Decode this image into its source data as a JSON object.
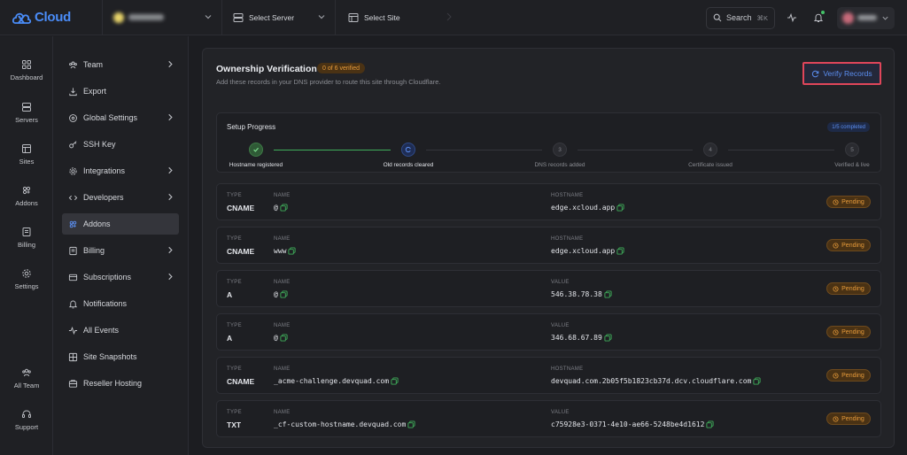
{
  "brand": {
    "name": "Cloud",
    "color": "#4a8cf7"
  },
  "topbar": {
    "server_label": "Select Server",
    "site_label": "Select Site",
    "search_label": "Search",
    "search_shortcut": "⌘K"
  },
  "rail": [
    {
      "label": "Dashboard",
      "icon": "grid-icon"
    },
    {
      "label": "Servers",
      "icon": "server-icon"
    },
    {
      "label": "Sites",
      "icon": "browser-icon"
    },
    {
      "label": "Addons",
      "icon": "addons-icon"
    },
    {
      "label": "Billing",
      "icon": "billing-icon"
    },
    {
      "label": "Settings",
      "icon": "gear-icon"
    },
    {
      "label": "All Team",
      "icon": "team-icon"
    },
    {
      "label": "Support",
      "icon": "headset-icon"
    }
  ],
  "menu": [
    {
      "label": "Team",
      "icon": "team-icon",
      "arrow": true
    },
    {
      "label": "Export",
      "icon": "export-icon",
      "arrow": false
    },
    {
      "label": "Global Settings",
      "icon": "globe-icon",
      "arrow": true
    },
    {
      "label": "SSH Key",
      "icon": "key-icon",
      "arrow": false
    },
    {
      "label": "Integrations",
      "icon": "puzzle-icon",
      "arrow": true
    },
    {
      "label": "Developers",
      "icon": "code-icon",
      "arrow": true
    },
    {
      "label": "Addons",
      "icon": "addons-icon",
      "arrow": false,
      "active": true
    },
    {
      "label": "Billing",
      "icon": "billing-icon",
      "arrow": true
    },
    {
      "label": "Subscriptions",
      "icon": "subscription-icon",
      "arrow": true
    },
    {
      "label": "Notifications",
      "icon": "bell-icon",
      "arrow": false
    },
    {
      "label": "All Events",
      "icon": "activity-icon",
      "arrow": false
    },
    {
      "label": "Site Snapshots",
      "icon": "snapshot-icon",
      "arrow": false
    },
    {
      "label": "Reseller Hosting",
      "icon": "reseller-icon",
      "arrow": false
    }
  ],
  "verification": {
    "title": "Ownership Verification",
    "badge": "0 of 6 verified",
    "subtitle": "Add these records in your DNS provider to route this site through Cloudflare.",
    "verify_button": "Verify Records"
  },
  "progress": {
    "title": "Setup Progress",
    "badge": "1/5 completed",
    "steps": [
      {
        "num": "",
        "label": "Hostname registered",
        "state": "done"
      },
      {
        "num": "",
        "label": "Old records cleared",
        "state": "current"
      },
      {
        "num": "3",
        "label": "DNS records added",
        "state": "todo"
      },
      {
        "num": "4",
        "label": "Certificate issued",
        "state": "todo"
      },
      {
        "num": "5",
        "label": "Verified & live",
        "state": "todo"
      }
    ]
  },
  "columns": {
    "type": "TYPE",
    "name": "NAME",
    "hostname": "HOSTNAME",
    "value": "VALUE"
  },
  "status_pending": "Pending",
  "records": [
    {
      "type": "CNAME",
      "name": "@",
      "target_caption": "HOSTNAME",
      "target": "edge.xcloud.app",
      "status": "Pending"
    },
    {
      "type": "CNAME",
      "name": "www",
      "target_caption": "HOSTNAME",
      "target": "edge.xcloud.app",
      "status": "Pending"
    },
    {
      "type": "A",
      "name": "@",
      "target_caption": "VALUE",
      "target": "546.38.78.38",
      "status": "Pending"
    },
    {
      "type": "A",
      "name": "@",
      "target_caption": "VALUE",
      "target": "346.68.67.89",
      "status": "Pending"
    },
    {
      "type": "CNAME",
      "name": "_acme-challenge.devquad.com",
      "target_caption": "HOSTNAME",
      "target": "devquad.com.2b05f5b1823cb37d.dcv.cloudflare.com",
      "status": "Pending"
    },
    {
      "type": "TXT",
      "name": "_cf-custom-hostname.devquad.com",
      "target_caption": "VALUE",
      "target": "c75928e3-0371-4e10-ae66-5248be4d1612",
      "status": "Pending"
    }
  ],
  "colors": {
    "accent": "#5b8ef0",
    "success": "#3fae5a",
    "warning": "#e79b3a",
    "highlight_border": "#e0465a"
  }
}
